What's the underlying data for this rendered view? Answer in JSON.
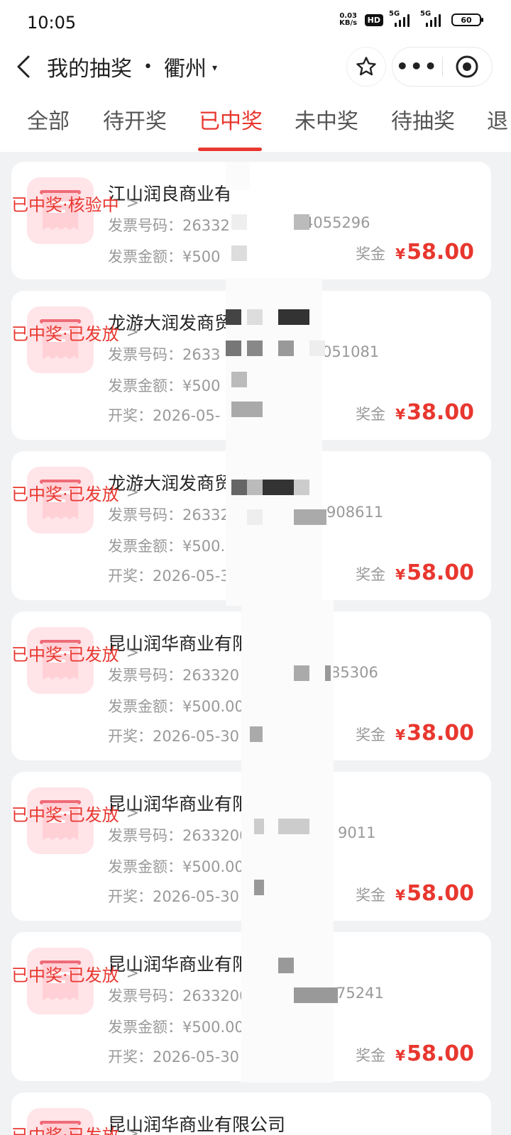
{
  "status_bar": {
    "time": "10:05",
    "net_speed_value": "0.03",
    "net_speed_unit": "KB/s",
    "hd_label": "HD",
    "signal_1": "5G",
    "signal_2": "5G",
    "battery": "60"
  },
  "nav": {
    "title": "我的抽奖",
    "separator": "•",
    "city": "衢州",
    "caret": "▾",
    "more": "•••"
  },
  "tabs": [
    {
      "label": "全部"
    },
    {
      "label": "待开奖"
    },
    {
      "label": "已中奖"
    },
    {
      "label": "未中奖"
    },
    {
      "label": "待抽奖"
    },
    {
      "label": "退"
    }
  ],
  "labels": {
    "invoice_no": "发票号码：",
    "invoice_amount": "发票金额：",
    "draw": "开奖：",
    "prize": "奖金",
    "currency": "¥",
    "chevron": ">"
  },
  "cards": [
    {
      "name": "江山润良商业有",
      "status": "已中奖·核验中",
      "invoice_no": "26332",
      "invoice_tail": "4055296",
      "amount": "¥500",
      "draw": "",
      "prize": "58.00"
    },
    {
      "name": "龙游大润发商贸",
      "status": "已中奖·已发放",
      "invoice_no": "2633",
      "invoice_tail": "051081",
      "amount": "¥500",
      "draw": "2026-05-",
      "prize": "38.00"
    },
    {
      "name": "龙游大润发商贸",
      "status": "已中奖·已发放",
      "invoice_no": "26332",
      "invoice_tail": "908611",
      "amount": "¥500.0",
      "draw": "2026-05-3",
      "prize": "58.00"
    },
    {
      "name": "昆山润华商业有限",
      "status": "已中奖·已发放",
      "invoice_no": "263320",
      "invoice_tail": "85306",
      "amount": "¥500.00",
      "draw": "2026-05-30",
      "prize": "38.00"
    },
    {
      "name": "昆山润华商业有限",
      "status": "已中奖·已发放",
      "invoice_no": "2633200",
      "invoice_tail": "9011",
      "amount": "¥500.00",
      "draw": "2026-05-30 (",
      "prize": "58.00"
    },
    {
      "name": "昆山润华商业有限",
      "status": "已中奖·已发放",
      "invoice_no": "26332000",
      "invoice_tail": "75241",
      "amount": "¥500.00",
      "draw": "2026-05-30 0",
      "prize": "58.00"
    },
    {
      "name": "昆山润华商业有限公司",
      "status": "已中奖·已发放",
      "invoice_no": "",
      "invoice_tail": "",
      "amount": "",
      "draw": "",
      "prize": ""
    }
  ]
}
